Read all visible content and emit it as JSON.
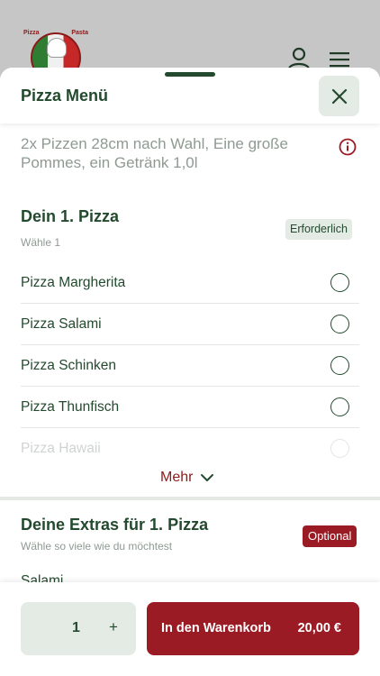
{
  "brand": {
    "logo_left_text": "Pizza",
    "logo_right_text": "Pasta",
    "logo_icon": "pizza-chef-logo"
  },
  "header_icons": {
    "user": "user-icon",
    "menu": "hamburger-menu-icon"
  },
  "sheet": {
    "title": "Pizza Menü",
    "close_icon": "close-icon",
    "description": "2x Pizzen 28cm nach Wahl, Eine große Pommes, ein Getränk 1,0l",
    "info_icon": "info-icon"
  },
  "section1": {
    "title": "Dein 1. Pizza",
    "subtitle": "Wähle 1",
    "badge": "Erforderlich",
    "options": [
      {
        "label": "Pizza Margherita"
      },
      {
        "label": "Pizza Salami"
      },
      {
        "label": "Pizza Schinken"
      },
      {
        "label": "Pizza Thunfisch"
      },
      {
        "label": "Pizza Hawaii"
      }
    ],
    "more_label": "Mehr"
  },
  "section2": {
    "title": "Deine Extras für 1. Pizza",
    "subtitle": "Wähle so viele wie du möchtest",
    "badge": "Optional",
    "first_item": "Salami"
  },
  "footer": {
    "quantity": "1",
    "plus_label": "+",
    "cart_label": "In den Warenkorb",
    "price": "20,00 €"
  },
  "colors": {
    "primary_green": "#234a2e",
    "accent_red": "#9b1b24",
    "muted": "#8e9a92",
    "light_green_bg": "#e4ebe5"
  }
}
